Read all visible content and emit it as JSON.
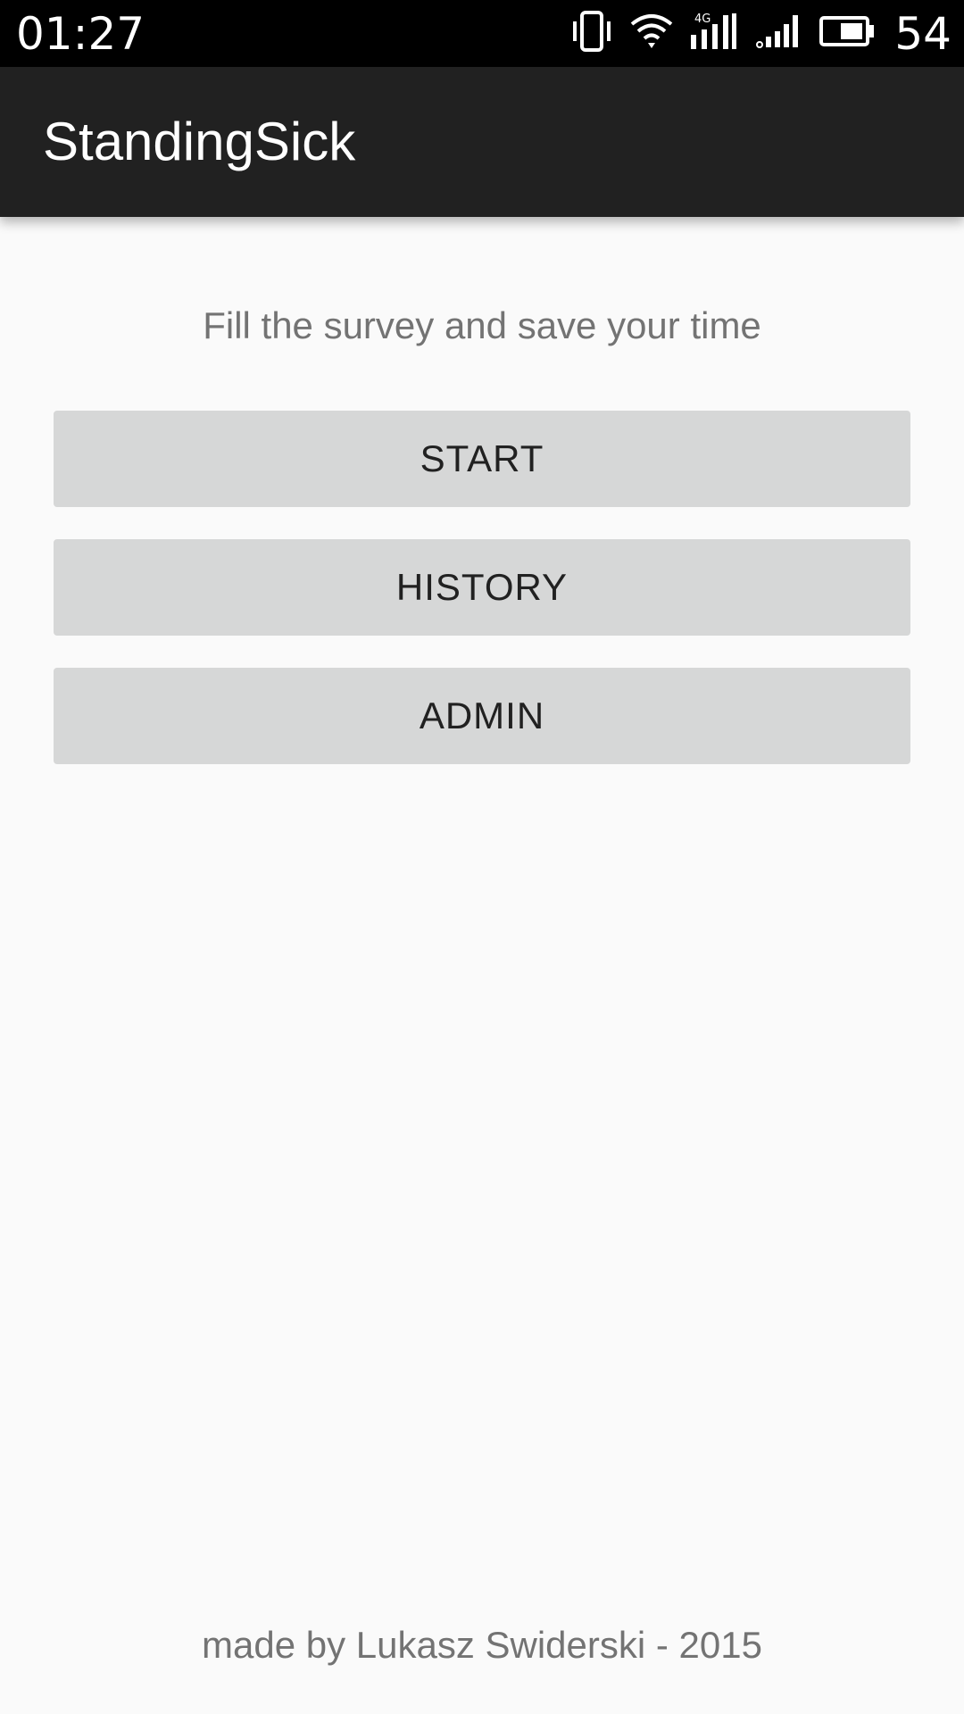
{
  "status_bar": {
    "time": "01:27",
    "battery_percent": "54",
    "network_label": "4G",
    "icons": [
      "vibrate-icon",
      "wifi-icon",
      "mobile-data-4g-icon",
      "signal-icon",
      "battery-icon"
    ]
  },
  "app_bar": {
    "title": "StandingSick",
    "background_color": "#212121"
  },
  "main": {
    "subtitle": "Fill the survey and save your time",
    "buttons": [
      {
        "label": "START"
      },
      {
        "label": "HISTORY"
      },
      {
        "label": "ADMIN"
      }
    ],
    "button_color": "#d6d7d7"
  },
  "footer": {
    "text": "made by Lukasz Swiderski - 2015"
  }
}
